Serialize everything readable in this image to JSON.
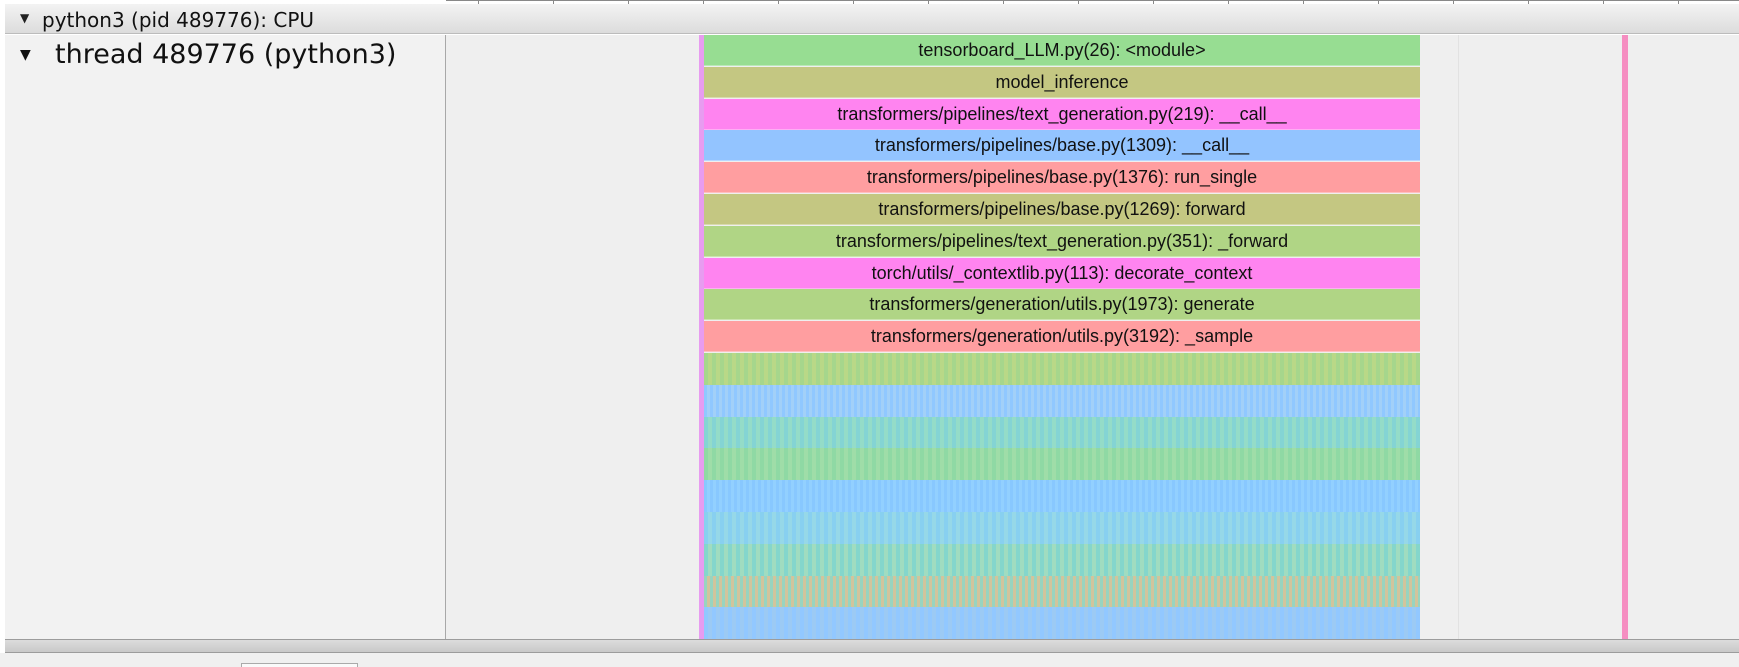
{
  "process": {
    "title": "python3 (pid 489776): CPU"
  },
  "thread": {
    "title": "thread 489776 (python3)"
  },
  "frames": [
    {
      "label": "tensorboard_LLM.py(26): <module>",
      "color": "#97dd92"
    },
    {
      "label": "model_inference",
      "color": "#c4c782"
    },
    {
      "label": "transformers/pipelines/text_generation.py(219): __call__",
      "color": "#ff84f0"
    },
    {
      "label": "transformers/pipelines/base.py(1309): __call__",
      "color": "#93c4ff"
    },
    {
      "label": "transformers/pipelines/base.py(1376): run_single",
      "color": "#ff9ea0"
    },
    {
      "label": "transformers/pipelines/base.py(1269): forward",
      "color": "#c4c782"
    },
    {
      "label": "transformers/pipelines/text_generation.py(351): _forward",
      "color": "#b0d585"
    },
    {
      "label": "torch/utils/_contextlib.py(113): decorate_context",
      "color": "#ff84f0"
    },
    {
      "label": "transformers/generation/utils.py(1973): generate",
      "color": "#b0d585"
    },
    {
      "label": "transformers/generation/utils.py(3192): _sample",
      "color": "#ff9ea0"
    }
  ],
  "stripes": [
    {
      "color_a": "#a6d68c",
      "color_b": "#b9d887"
    },
    {
      "color_a": "#90c8ff",
      "color_b": "#a2d0f8"
    },
    {
      "color_a": "#84d4d4",
      "color_b": "#94dcc8"
    },
    {
      "color_a": "#8fd9a4",
      "color_b": "#9fdda8"
    },
    {
      "color_a": "#88c8ff",
      "color_b": "#92d0ff"
    },
    {
      "color_a": "#88d0f0",
      "color_b": "#96d8e8"
    },
    {
      "color_a": "#84d6cc",
      "color_b": "#a0dcc0"
    },
    {
      "color_a": "#98d4c0",
      "color_b": "#d2c49c"
    },
    {
      "color_a": "#92c8ff",
      "color_b": "#9ccaf4"
    }
  ]
}
